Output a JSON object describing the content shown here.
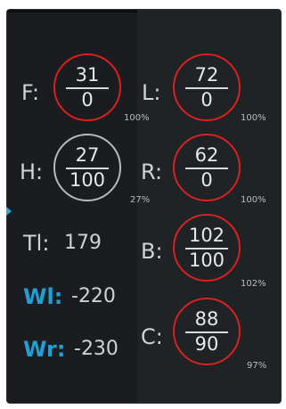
{
  "gauges": [
    {
      "id": "f",
      "label": "F:",
      "top_value": "31",
      "bottom_value": "0",
      "percent": "100%",
      "ring_color": "#d9201f"
    },
    {
      "id": "l",
      "label": "L:",
      "top_value": "72",
      "bottom_value": "0",
      "percent": "100%",
      "ring_color": "#d9201f"
    },
    {
      "id": "h",
      "label": "H:",
      "top_value": "27",
      "bottom_value": "100",
      "percent": "27%",
      "ring_color": "#b7b9bb"
    },
    {
      "id": "r",
      "label": "R:",
      "top_value": "62",
      "bottom_value": "0",
      "percent": "100%",
      "ring_color": "#d9201f"
    },
    {
      "id": "b",
      "label": "B:",
      "top_value": "102",
      "bottom_value": "100",
      "percent": "102%",
      "ring_color": "#d9201f"
    },
    {
      "id": "c",
      "label": "C:",
      "top_value": "88",
      "bottom_value": "90",
      "percent": "97%",
      "ring_color": "#d9201f"
    }
  ],
  "stats": {
    "tl_label": "Tl:",
    "tl_value": "179",
    "wl_label": "Wl:",
    "wl_value": "-220",
    "wr_label": "Wr:",
    "wr_value": "-230"
  },
  "colors": {
    "panel_bg": "#1a1c1f",
    "accent_blue": "#1f9fd3",
    "alert_red": "#d9201f",
    "neutral_grey": "#b7b9bb"
  }
}
